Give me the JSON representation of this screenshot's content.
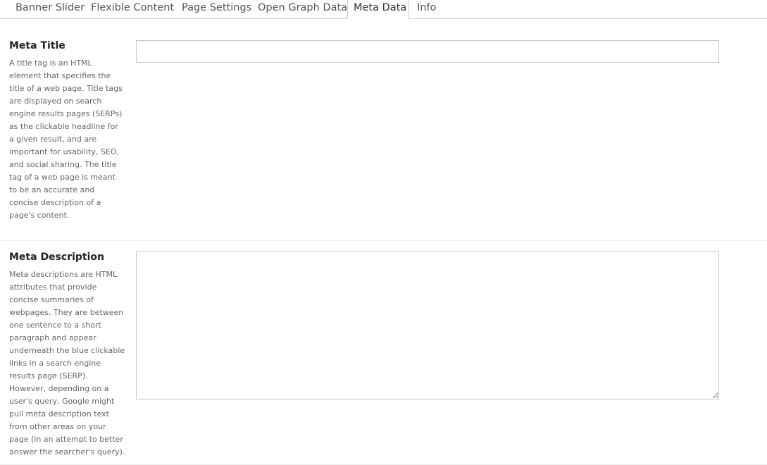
{
  "tabs": [
    {
      "label": "Banner Slider",
      "active": false
    },
    {
      "label": "Flexible Content",
      "active": false
    },
    {
      "label": "Page Settings",
      "active": false
    },
    {
      "label": "Open Graph Data",
      "active": false
    },
    {
      "label": "Meta Data",
      "active": true
    },
    {
      "label": "Info",
      "active": false
    }
  ],
  "fields": {
    "meta_title": {
      "label": "Meta Title",
      "help": "A title tag is an HTML element that specifies the title of a web page. Title tags are displayed on search engine results pages (SERPs) as the clickable headline for a given result, and are important for usability, SEO, and social sharing. The title tag of a web page is meant to be an accurate and concise description of a page's content.",
      "value": ""
    },
    "meta_description": {
      "label": "Meta Description",
      "help": "Meta descriptions are HTML attributes that provide concise summaries of webpages. They are between one sentence to a short paragraph and appear underneath the blue clickable links in a search engine results page (SERP). However, depending on a user's query, Google might pull meta description text from other areas on your page (in an attempt to better answer the searcher's query).",
      "value": ""
    }
  }
}
